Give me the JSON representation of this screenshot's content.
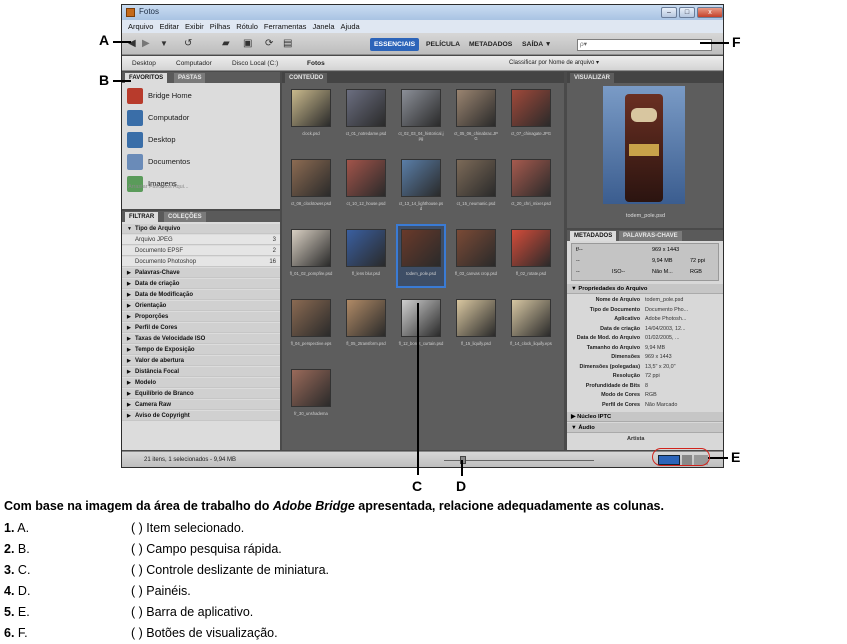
{
  "window": {
    "title": "Fotos",
    "menu": [
      "Arquivo",
      "Editar",
      "Exibir",
      "Pilhas",
      "Rótulo",
      "Ferramentas",
      "Janela",
      "Ajuda"
    ],
    "workspaces": [
      "ESSENCIAIS",
      "PELÍCULA",
      "METADADOS",
      "SAÍDA ▼"
    ],
    "search_placeholder": "ρ▾",
    "path": [
      "Desktop",
      "Computador",
      "Disco Local (C:)",
      "Fotos"
    ],
    "sort_label": "Classificar por Nome de arquivo ▾"
  },
  "left_panel": {
    "tabs": [
      "FAVORITOS",
      "PASTAS"
    ],
    "favorites": [
      "Bridge Home",
      "Computador",
      "Desktop",
      "Documentos",
      "Imagens"
    ],
    "favorites_hint": "Arrastar Favoritos Aqui...",
    "filter_tabs": [
      "FILTRAR",
      "COLEÇÕES"
    ],
    "filter_category_open": "Tipo de Arquivo",
    "filter_items": [
      {
        "label": "Arquivo JPEG",
        "count": "3"
      },
      {
        "label": "Documento EPSF",
        "count": "2"
      },
      {
        "label": "Documento Photoshop",
        "count": "16"
      }
    ],
    "filter_categories": [
      "Palavras-Chave",
      "Data de criação",
      "Data de Modificação",
      "Orientação",
      "Proporções",
      "Perfil de Cores",
      "Taxas de Velocidade ISO",
      "Tempo de Exposição",
      "Valor de abertura",
      "Distância Focal",
      "Modelo",
      "Equilíbrio de Branco",
      "Camera Raw",
      "Aviso de Copyright"
    ]
  },
  "content": {
    "tab": "CONTEÚDO",
    "thumbnails": [
      {
        "cap": "clock.psd",
        "color": "#c9b98c"
      },
      {
        "cap": "ct_01_notredame.psd",
        "color": "#6b6e80"
      },
      {
        "cap": "ct_02_03_04_historical.jpg",
        "color": "#8b8f98"
      },
      {
        "cap": "ct_05_06_chinabrac.JPG",
        "color": "#9a8470"
      },
      {
        "cap": "ct_07_chinagate.JPG",
        "color": "#a0493a"
      },
      {
        "cap": "ct_08_clocktower.psd",
        "color": "#8c6b52"
      },
      {
        "cap": "ct_10_12_house.psd",
        "color": "#a2544a"
      },
      {
        "cap": "ct_13_14_lighthouse.psd",
        "color": "#5a7ea8"
      },
      {
        "cap": "ct_15_neumanic.psd",
        "color": "#7c6a58"
      },
      {
        "cap": "ct_20_chri_mixer.psd",
        "color": "#a65a4e"
      },
      {
        "cap": "fl_01_02_pompfire.psd",
        "color": "#d8cfc2"
      },
      {
        "cap": "fl_lens blur.psd",
        "color": "#3a5fa0"
      },
      {
        "cap": "todem_pole.psd",
        "color": "#6a3a2a"
      },
      {
        "cap": "fl_03_canvas crop.psd",
        "color": "#7a4a36"
      },
      {
        "cap": "fl_02_rotate.psd",
        "color": "#d34c3a"
      },
      {
        "cap": "fl_04_perspective.eps",
        "color": "#8a6a52"
      },
      {
        "cap": "fl_05_2transform.psd",
        "color": "#b08a66"
      },
      {
        "cap": "fl_12_bonet_curtain.psd",
        "color": "#cfcfcf"
      },
      {
        "cap": "fl_15_liquify.psd",
        "color": "#d9c7a0"
      },
      {
        "cap": "fl_14_clock_liquify.eps",
        "color": "#d6c6a2"
      },
      {
        "cap": "fr_30_unshadema",
        "color": "#9a6a5a"
      }
    ]
  },
  "right_panel": {
    "preview_tab": "VISUALIZAR",
    "preview_caption": "todem_pole.psd",
    "meta_tabs": [
      "METADADOS",
      "PALAVRAS-CHAVE"
    ],
    "quick": [
      [
        "f/--",
        "969 x 1443"
      ],
      [
        "--",
        "9,94 MB",
        "72 ppi"
      ],
      [
        "--",
        "ISO--",
        "Não M...",
        "RGB"
      ]
    ],
    "section": "Propriedades do Arquivo",
    "props": [
      {
        "k": "Nome de Arquivo",
        "v": "todem_pole.psd"
      },
      {
        "k": "Tipo de Documento",
        "v": "Documento Pho..."
      },
      {
        "k": "Aplicativo",
        "v": "Adobe Photosh..."
      },
      {
        "k": "Data de criação",
        "v": "14/04/2003, 12..."
      },
      {
        "k": "Data de Mod. do Arquivo",
        "v": "01/02/2005, ..."
      },
      {
        "k": "Tamanho do Arquivo",
        "v": "9,94 MB"
      },
      {
        "k": "Dimensões",
        "v": "969 x 1443"
      },
      {
        "k": "Dimensões (polegadas)",
        "v": "13,5\" x 20,0\""
      },
      {
        "k": "Resolução",
        "v": "72 ppi"
      },
      {
        "k": "Profundidade de Bits",
        "v": "8"
      },
      {
        "k": "Modo de Cores",
        "v": "RGB"
      },
      {
        "k": "Perfil de Cores",
        "v": "Não Marcado"
      }
    ],
    "sections_after": [
      "Núcleo IPTC",
      "Áudio"
    ],
    "cut_label": "Artista"
  },
  "status": {
    "text": "21 itens, 1 selecionados - 9,94 MB"
  },
  "callouts": [
    "A",
    "B",
    "C",
    "D",
    "E",
    "F"
  ],
  "question": {
    "intro_before": "Com base na imagem da área de trabalho do ",
    "intro_italic": "Adobe Bridge",
    "intro_after": " apresentada, relacione adequadamente as colunas.",
    "left": [
      {
        "num": "1.",
        "letter": "A."
      },
      {
        "num": "2.",
        "letter": "B."
      },
      {
        "num": "3.",
        "letter": "C."
      },
      {
        "num": "4.",
        "letter": "D."
      },
      {
        "num": "5.",
        "letter": "E."
      },
      {
        "num": "6.",
        "letter": "F."
      }
    ],
    "right": [
      "(     ) Item selecionado.",
      "(     ) Campo pesquisa rápida.",
      "(     ) Controle deslizante de miniatura.",
      "(     ) Painéis.",
      "(     ) Barra de aplicativo.",
      "(     ) Botões de visualização."
    ]
  }
}
